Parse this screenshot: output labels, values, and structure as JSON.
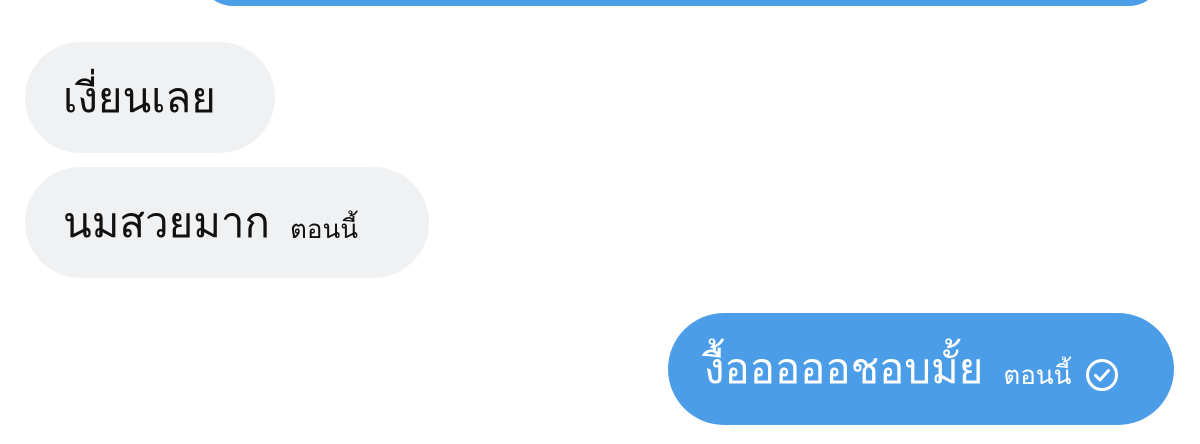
{
  "conversation": {
    "messages": [
      {
        "direction": "incoming",
        "text": "เงี่ยนเลย"
      },
      {
        "direction": "incoming",
        "text": "นมสวยมาก",
        "time": "ตอนนี้"
      },
      {
        "direction": "outgoing",
        "text": "งื้อออออชอบมั้ย",
        "time": "ตอนนี้",
        "status_icon": "check-circle-icon"
      }
    ]
  },
  "colors": {
    "outgoing_bubble": "#4c9de8",
    "incoming_bubble": "#eff1f3",
    "incoming_text": "#111111",
    "outgoing_text": "#ffffff",
    "background": "#ffffff"
  }
}
